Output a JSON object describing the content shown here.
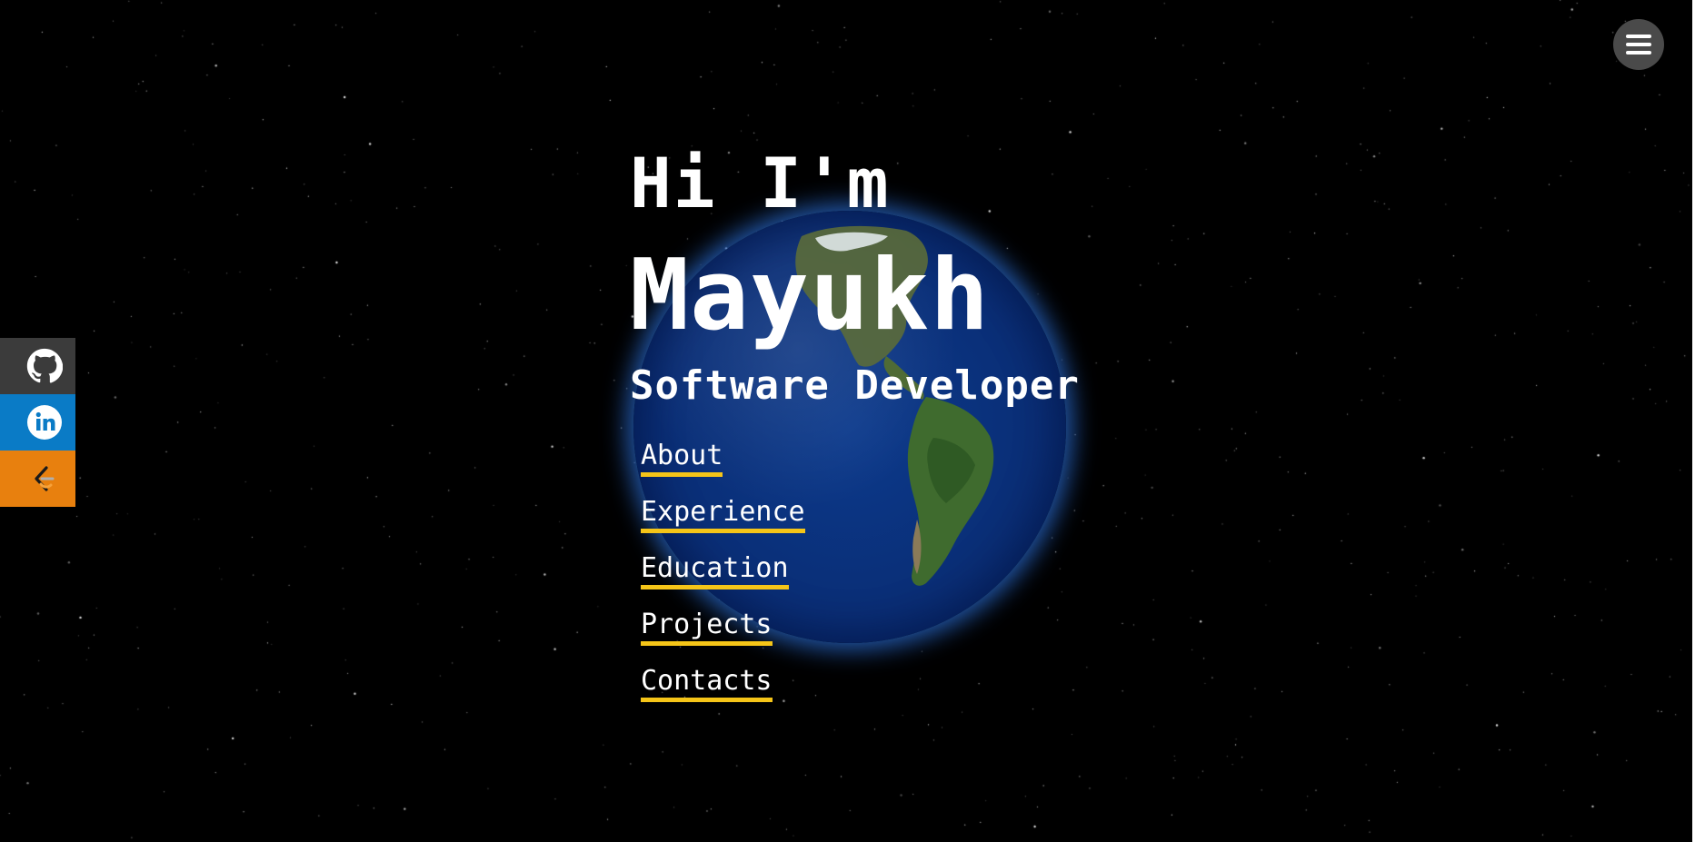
{
  "hero": {
    "greeting": "Hi I'm",
    "name": "Mayukh",
    "role": "Software Developer"
  },
  "nav": {
    "links": [
      {
        "label": "About"
      },
      {
        "label": "Experience"
      },
      {
        "label": "Education"
      },
      {
        "label": "Projects"
      },
      {
        "label": "Contacts"
      }
    ]
  },
  "social": {
    "items": [
      {
        "icon": "github-icon",
        "color": "#3b3b3b"
      },
      {
        "icon": "linkedin-icon",
        "color": "#0a7bc6"
      },
      {
        "icon": "leetcode-icon",
        "color": "#e8800e"
      }
    ]
  },
  "menu": {
    "icon": "hamburger-menu-icon"
  },
  "colors": {
    "background": "#000000",
    "link_underline": "#f5c518",
    "text": "#ffffff"
  }
}
